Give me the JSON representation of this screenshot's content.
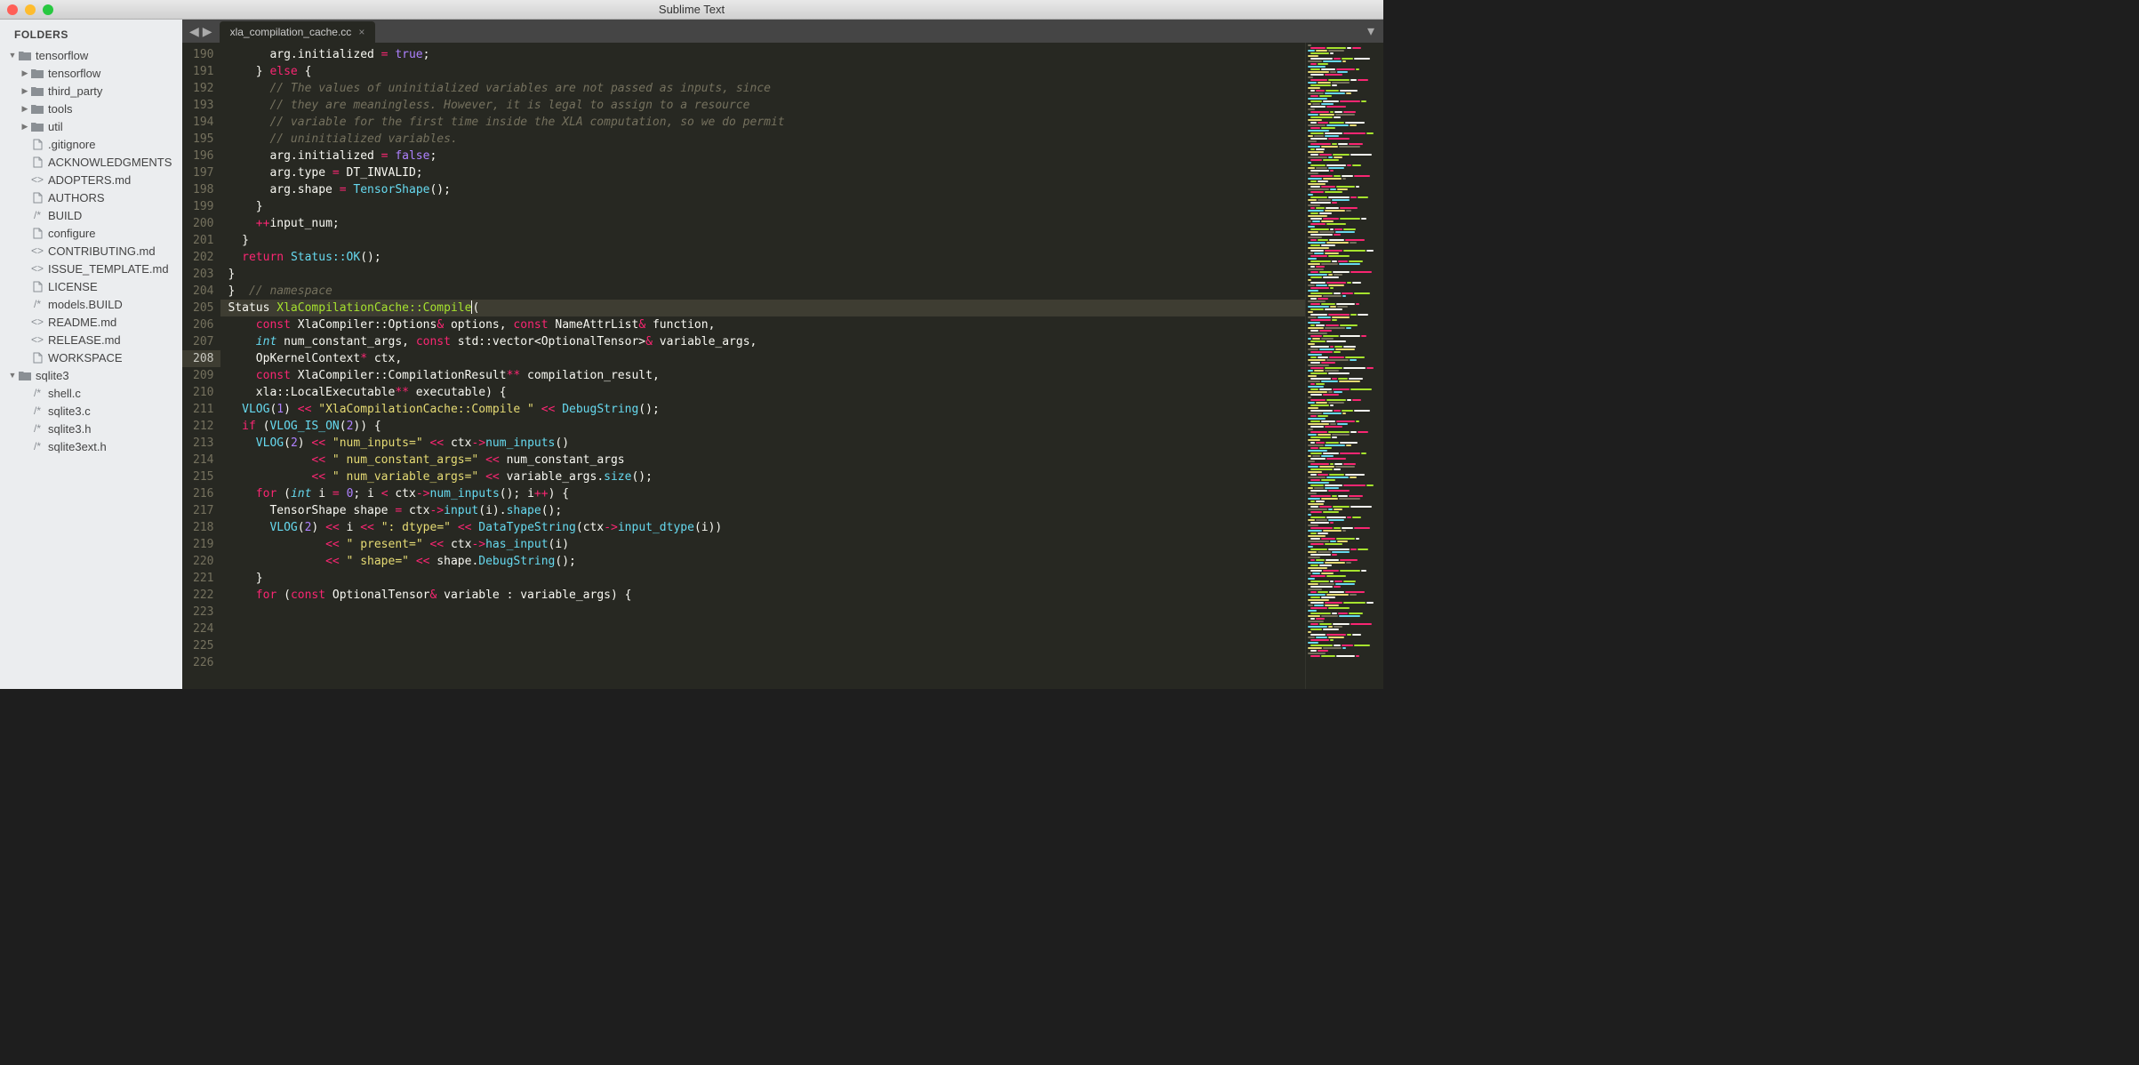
{
  "window": {
    "title": "Sublime Text"
  },
  "sidebar": {
    "header": "FOLDERS",
    "tree": [
      {
        "type": "folder",
        "name": "tensorflow",
        "depth": 0,
        "expanded": true
      },
      {
        "type": "folder",
        "name": "tensorflow",
        "depth": 1,
        "expanded": false
      },
      {
        "type": "folder",
        "name": "third_party",
        "depth": 1,
        "expanded": false
      },
      {
        "type": "folder",
        "name": "tools",
        "depth": 1,
        "expanded": false
      },
      {
        "type": "folder",
        "name": "util",
        "depth": 1,
        "expanded": false
      },
      {
        "type": "file",
        "name": ".gitignore",
        "depth": 1,
        "icon": "file"
      },
      {
        "type": "file",
        "name": "ACKNOWLEDGMENTS",
        "depth": 1,
        "icon": "file"
      },
      {
        "type": "file",
        "name": "ADOPTERS.md",
        "depth": 1,
        "icon": "code"
      },
      {
        "type": "file",
        "name": "AUTHORS",
        "depth": 1,
        "icon": "file"
      },
      {
        "type": "file",
        "name": "BUILD",
        "depth": 1,
        "icon": "cmt"
      },
      {
        "type": "file",
        "name": "configure",
        "depth": 1,
        "icon": "file"
      },
      {
        "type": "file",
        "name": "CONTRIBUTING.md",
        "depth": 1,
        "icon": "code"
      },
      {
        "type": "file",
        "name": "ISSUE_TEMPLATE.md",
        "depth": 1,
        "icon": "code"
      },
      {
        "type": "file",
        "name": "LICENSE",
        "depth": 1,
        "icon": "file"
      },
      {
        "type": "file",
        "name": "models.BUILD",
        "depth": 1,
        "icon": "cmt"
      },
      {
        "type": "file",
        "name": "README.md",
        "depth": 1,
        "icon": "code"
      },
      {
        "type": "file",
        "name": "RELEASE.md",
        "depth": 1,
        "icon": "code"
      },
      {
        "type": "file",
        "name": "WORKSPACE",
        "depth": 1,
        "icon": "file"
      },
      {
        "type": "folder",
        "name": "sqlite3",
        "depth": 0,
        "expanded": true
      },
      {
        "type": "file",
        "name": "shell.c",
        "depth": 1,
        "icon": "cmt"
      },
      {
        "type": "file",
        "name": "sqlite3.c",
        "depth": 1,
        "icon": "cmt"
      },
      {
        "type": "file",
        "name": "sqlite3.h",
        "depth": 1,
        "icon": "cmt"
      },
      {
        "type": "file",
        "name": "sqlite3ext.h",
        "depth": 1,
        "icon": "cmt"
      }
    ]
  },
  "tabs": {
    "active": {
      "name": "xla_compilation_cache.cc"
    }
  },
  "editor": {
    "first_line_number": 190,
    "active_line_number": 208,
    "lines": [
      [
        [
          "      arg.initialized ",
          "var"
        ],
        [
          "=",
          "op"
        ],
        [
          " ",
          ""
        ],
        [
          "true",
          "num"
        ],
        [
          ";",
          ""
        ]
      ],
      [
        [
          "    } ",
          ""
        ],
        [
          "else",
          "kw"
        ],
        [
          " {",
          ""
        ]
      ],
      [
        [
          "      ",
          ""
        ],
        [
          "// The values of uninitialized variables are not passed as inputs, since",
          "cmt"
        ]
      ],
      [
        [
          "      ",
          ""
        ],
        [
          "// they are meaningless. However, it is legal to assign to a resource",
          "cmt"
        ]
      ],
      [
        [
          "      ",
          ""
        ],
        [
          "// variable for the first time inside the XLA computation, so we do permit",
          "cmt"
        ]
      ],
      [
        [
          "      ",
          ""
        ],
        [
          "// uninitialized variables.",
          "cmt"
        ]
      ],
      [
        [
          "      arg.initialized ",
          "var"
        ],
        [
          "=",
          "op"
        ],
        [
          " ",
          ""
        ],
        [
          "false",
          "num"
        ],
        [
          ";",
          ""
        ]
      ],
      [
        [
          "      arg.type ",
          "var"
        ],
        [
          "=",
          "op"
        ],
        [
          " DT_INVALID;",
          ""
        ]
      ],
      [
        [
          "      arg.shape ",
          "var"
        ],
        [
          "=",
          "op"
        ],
        [
          " ",
          ""
        ],
        [
          "TensorShape",
          "call"
        ],
        [
          "();",
          ""
        ]
      ],
      [
        [
          "    }",
          ""
        ]
      ],
      [
        [
          "    ",
          ""
        ],
        [
          "++",
          "op"
        ],
        [
          "input_num;",
          ""
        ]
      ],
      [
        [
          "  }",
          ""
        ]
      ],
      [
        [
          "",
          ""
        ]
      ],
      [
        [
          "  ",
          ""
        ],
        [
          "return",
          "kw"
        ],
        [
          " ",
          ""
        ],
        [
          "Status::OK",
          "call"
        ],
        [
          "();",
          ""
        ]
      ],
      [
        [
          "}",
          ""
        ]
      ],
      [
        [
          "",
          ""
        ]
      ],
      [
        [
          "}  ",
          ""
        ],
        [
          "// namespace",
          "cmt"
        ]
      ],
      [
        [
          "",
          ""
        ]
      ],
      [
        [
          "Status ",
          ""
        ],
        [
          "XlaCompilationCache::Compile",
          "fn"
        ],
        [
          "(",
          ""
        ]
      ],
      [
        [
          "    ",
          ""
        ],
        [
          "const",
          "kw"
        ],
        [
          " XlaCompiler::Options",
          ""
        ],
        [
          "&",
          "op"
        ],
        [
          " options, ",
          ""
        ],
        [
          "const",
          "kw"
        ],
        [
          " NameAttrList",
          ""
        ],
        [
          "&",
          "op"
        ],
        [
          " function,",
          ""
        ]
      ],
      [
        [
          "    ",
          ""
        ],
        [
          "int",
          "type"
        ],
        [
          " num_constant_args, ",
          ""
        ],
        [
          "const",
          "kw"
        ],
        [
          " std::vector<OptionalTensor>",
          ""
        ],
        [
          "&",
          "op"
        ],
        [
          " variable_args,",
          ""
        ]
      ],
      [
        [
          "    OpKernelContext",
          ""
        ],
        [
          "*",
          "op"
        ],
        [
          " ctx,",
          ""
        ]
      ],
      [
        [
          "    ",
          ""
        ],
        [
          "const",
          "kw"
        ],
        [
          " XlaCompiler::CompilationResult",
          ""
        ],
        [
          "**",
          "op"
        ],
        [
          " compilation_result,",
          ""
        ]
      ],
      [
        [
          "    xla::LocalExecutable",
          ""
        ],
        [
          "**",
          "op"
        ],
        [
          " executable) {",
          ""
        ]
      ],
      [
        [
          "  ",
          ""
        ],
        [
          "VLOG",
          "call"
        ],
        [
          "(",
          ""
        ],
        [
          "1",
          "num"
        ],
        [
          ") ",
          ""
        ],
        [
          "<<",
          "op"
        ],
        [
          " ",
          ""
        ],
        [
          "\"XlaCompilationCache::Compile \"",
          "str"
        ],
        [
          " ",
          ""
        ],
        [
          "<<",
          "op"
        ],
        [
          " ",
          ""
        ],
        [
          "DebugString",
          "call"
        ],
        [
          "();",
          ""
        ]
      ],
      [
        [
          "",
          ""
        ]
      ],
      [
        [
          "  ",
          ""
        ],
        [
          "if",
          "kw"
        ],
        [
          " (",
          ""
        ],
        [
          "VLOG_IS_ON",
          "call"
        ],
        [
          "(",
          ""
        ],
        [
          "2",
          "num"
        ],
        [
          ")) {",
          ""
        ]
      ],
      [
        [
          "    ",
          ""
        ],
        [
          "VLOG",
          "call"
        ],
        [
          "(",
          ""
        ],
        [
          "2",
          "num"
        ],
        [
          ") ",
          ""
        ],
        [
          "<<",
          "op"
        ],
        [
          " ",
          ""
        ],
        [
          "\"num_inputs=\"",
          "str"
        ],
        [
          " ",
          ""
        ],
        [
          "<<",
          "op"
        ],
        [
          " ctx",
          ""
        ],
        [
          "->",
          "op"
        ],
        [
          "num_inputs",
          "prop"
        ],
        [
          "()",
          ""
        ]
      ],
      [
        [
          "            ",
          ""
        ],
        [
          "<<",
          "op"
        ],
        [
          " ",
          ""
        ],
        [
          "\" num_constant_args=\"",
          "str"
        ],
        [
          " ",
          ""
        ],
        [
          "<<",
          "op"
        ],
        [
          " num_constant_args",
          ""
        ]
      ],
      [
        [
          "            ",
          ""
        ],
        [
          "<<",
          "op"
        ],
        [
          " ",
          ""
        ],
        [
          "\" num_variable_args=\"",
          "str"
        ],
        [
          " ",
          ""
        ],
        [
          "<<",
          "op"
        ],
        [
          " variable_args.",
          ""
        ],
        [
          "size",
          "call"
        ],
        [
          "();",
          ""
        ]
      ],
      [
        [
          "    ",
          ""
        ],
        [
          "for",
          "kw"
        ],
        [
          " (",
          ""
        ],
        [
          "int",
          "type"
        ],
        [
          " i ",
          ""
        ],
        [
          "=",
          "op"
        ],
        [
          " ",
          ""
        ],
        [
          "0",
          "num"
        ],
        [
          "; i ",
          ""
        ],
        [
          "<",
          "op"
        ],
        [
          " ctx",
          ""
        ],
        [
          "->",
          "op"
        ],
        [
          "num_inputs",
          "prop"
        ],
        [
          "(); i",
          ""
        ],
        [
          "++",
          "op"
        ],
        [
          ") {",
          ""
        ]
      ],
      [
        [
          "      TensorShape shape ",
          ""
        ],
        [
          "=",
          "op"
        ],
        [
          " ctx",
          ""
        ],
        [
          "->",
          "op"
        ],
        [
          "input",
          "prop"
        ],
        [
          "(i).",
          ""
        ],
        [
          "shape",
          "call"
        ],
        [
          "();",
          ""
        ]
      ],
      [
        [
          "      ",
          ""
        ],
        [
          "VLOG",
          "call"
        ],
        [
          "(",
          ""
        ],
        [
          "2",
          "num"
        ],
        [
          ") ",
          ""
        ],
        [
          "<<",
          "op"
        ],
        [
          " i ",
          ""
        ],
        [
          "<<",
          "op"
        ],
        [
          " ",
          ""
        ],
        [
          "\": dtype=\"",
          "str"
        ],
        [
          " ",
          ""
        ],
        [
          "<<",
          "op"
        ],
        [
          " ",
          ""
        ],
        [
          "DataTypeString",
          "call"
        ],
        [
          "(ctx",
          ""
        ],
        [
          "->",
          "op"
        ],
        [
          "input_dtype",
          "prop"
        ],
        [
          "(i))",
          ""
        ]
      ],
      [
        [
          "              ",
          ""
        ],
        [
          "<<",
          "op"
        ],
        [
          " ",
          ""
        ],
        [
          "\" present=\"",
          "str"
        ],
        [
          " ",
          ""
        ],
        [
          "<<",
          "op"
        ],
        [
          " ctx",
          ""
        ],
        [
          "->",
          "op"
        ],
        [
          "has_input",
          "prop"
        ],
        [
          "(i)",
          ""
        ]
      ],
      [
        [
          "              ",
          ""
        ],
        [
          "<<",
          "op"
        ],
        [
          " ",
          ""
        ],
        [
          "\" shape=\"",
          "str"
        ],
        [
          " ",
          ""
        ],
        [
          "<<",
          "op"
        ],
        [
          " shape.",
          ""
        ],
        [
          "DebugString",
          "call"
        ],
        [
          "();",
          ""
        ]
      ],
      [
        [
          "    }",
          ""
        ]
      ],
      [
        [
          "    ",
          ""
        ],
        [
          "for",
          "kw"
        ],
        [
          " (",
          ""
        ],
        [
          "const",
          "kw"
        ],
        [
          " OptionalTensor",
          ""
        ],
        [
          "&",
          "op"
        ],
        [
          " variable : variable_args) {",
          ""
        ]
      ]
    ]
  }
}
